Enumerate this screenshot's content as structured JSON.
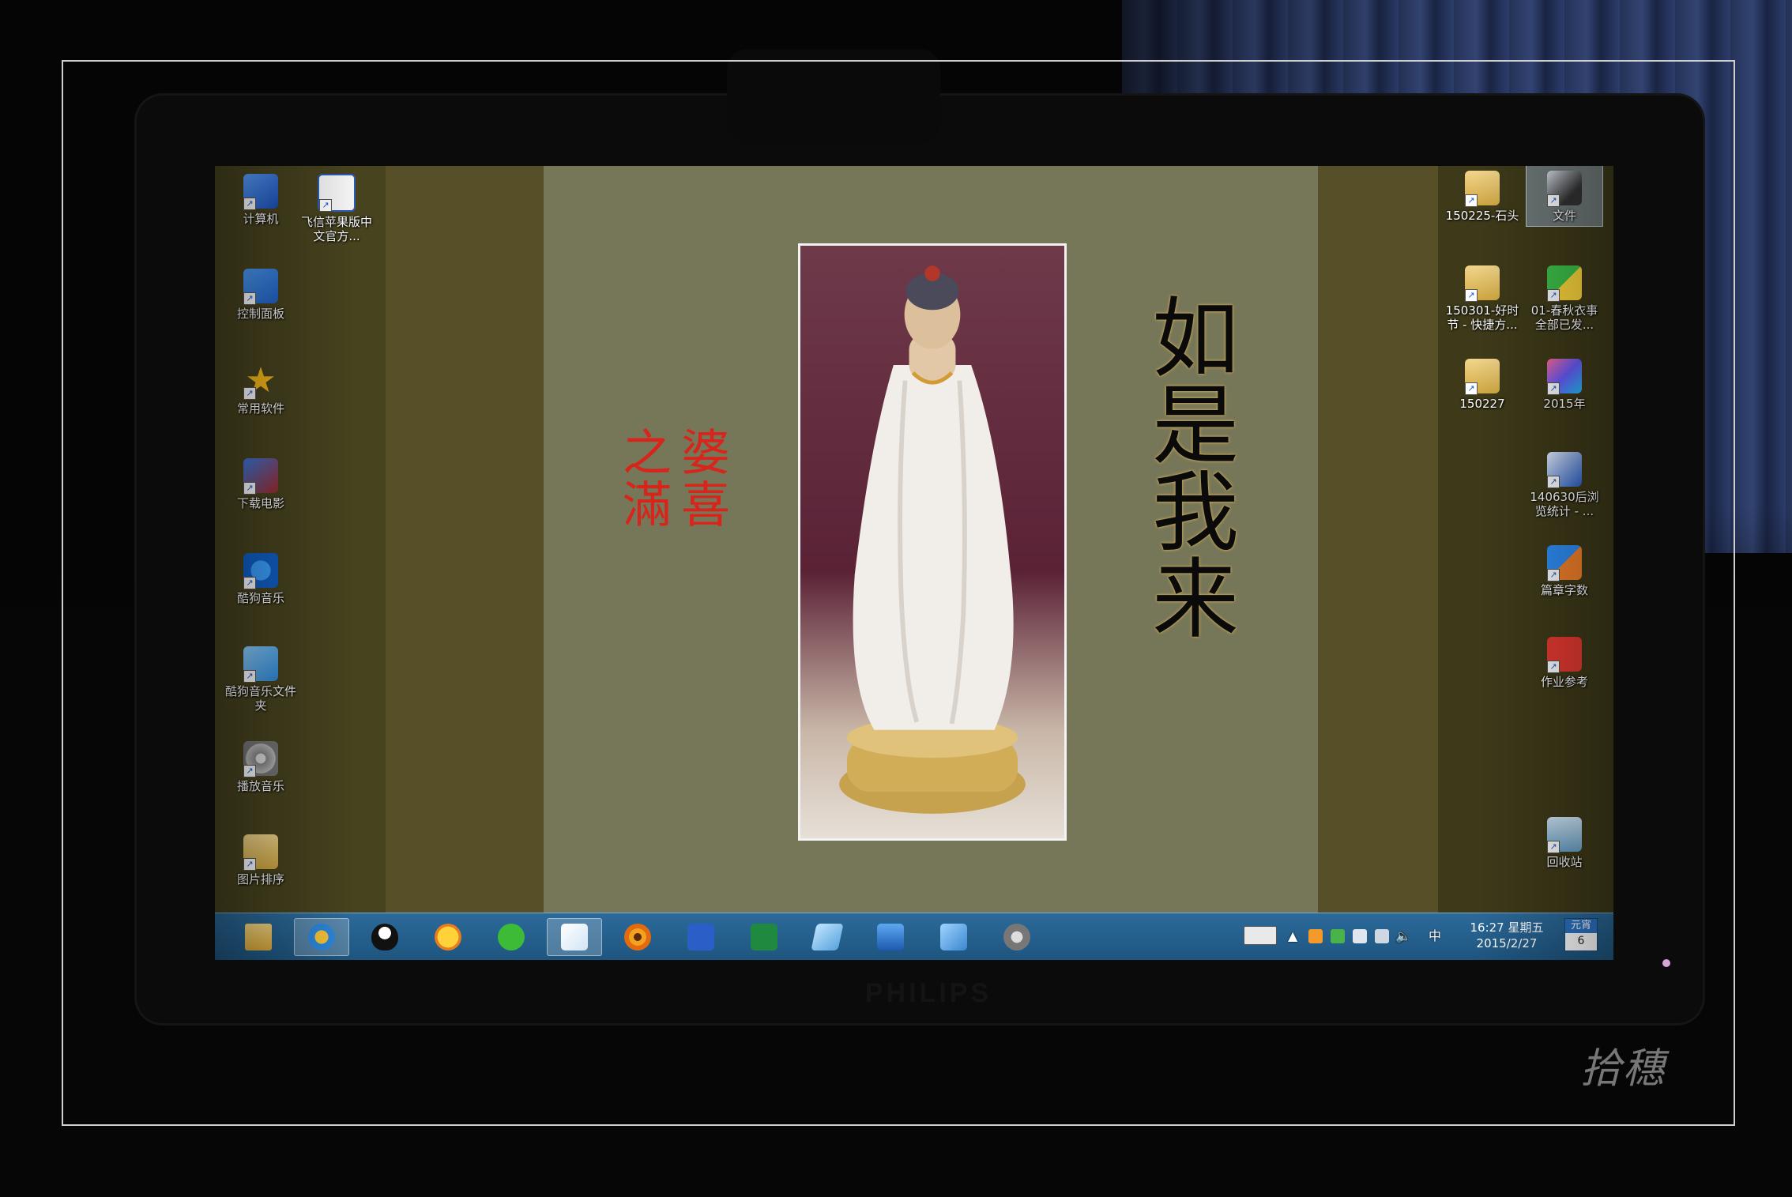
{
  "desktop": {
    "left_icons": [
      {
        "label": "计算机",
        "icon": "computer-icon"
      },
      {
        "label": "飞信苹果版中文官方...",
        "icon": "word-document-icon"
      },
      {
        "label": "控制面板",
        "icon": "control-panel-icon"
      },
      {
        "label": "常用软件",
        "icon": "star-folder-icon"
      },
      {
        "label": "下载电影",
        "icon": "film-download-icon"
      },
      {
        "label": "酷狗音乐",
        "icon": "kugou-icon"
      },
      {
        "label": "酷狗音乐文件夹",
        "icon": "music-folder-icon"
      },
      {
        "label": "播放音乐",
        "icon": "dvd-icon"
      },
      {
        "label": "图片排序",
        "icon": "folder-icon"
      }
    ],
    "right_icons": [
      {
        "label": "150225-石头",
        "icon": "folder-icon"
      },
      {
        "label": "文件",
        "icon": "photo-icon",
        "selected": true
      },
      {
        "label": "150301-好时节 - 快捷方...",
        "icon": "folder-icon"
      },
      {
        "label": "01-春秋衣事全部已发...",
        "icon": "green-app-icon"
      },
      {
        "label": "150227",
        "icon": "folder-icon"
      },
      {
        "label": "2015年",
        "icon": "colorful-app-icon"
      },
      {
        "label": "140630后浏览统计 - ...",
        "icon": "stats-icon"
      },
      {
        "label": "篇章字数",
        "icon": "butterfly-icon"
      },
      {
        "label": "作业参考",
        "icon": "seal-app-icon"
      },
      {
        "label": "回收站",
        "icon": "recycle-bin-icon"
      }
    ]
  },
  "wallpaper": {
    "calligraphy": "如是我来",
    "seal_text": "婆喜之滿"
  },
  "taskbar": {
    "pinned": [
      {
        "name": "file-explorer-icon",
        "active": false
      },
      {
        "name": "browser-icon",
        "active": true
      },
      {
        "name": "qq-icon",
        "active": false
      },
      {
        "name": "chat-icon",
        "active": false
      },
      {
        "name": "wechat-icon",
        "active": false
      },
      {
        "name": "pen-tool-icon",
        "active": true
      },
      {
        "name": "image-viewer-icon",
        "active": false
      },
      {
        "name": "word-icon",
        "active": false
      },
      {
        "name": "excel-icon",
        "active": false
      },
      {
        "name": "glass-app-icon",
        "active": false
      },
      {
        "name": "remote-desktop-icon",
        "active": false
      },
      {
        "name": "control-panel-icon",
        "active": false
      },
      {
        "name": "settings-gear-icon",
        "active": false
      }
    ],
    "tray": {
      "ime": "中",
      "time": "16:27 星期五",
      "date": "2015/2/27",
      "calendar_top": "元宵",
      "calendar_day": "6"
    }
  },
  "monitor": {
    "brand": "PHILIPS"
  },
  "photo_signature": "拾穗"
}
